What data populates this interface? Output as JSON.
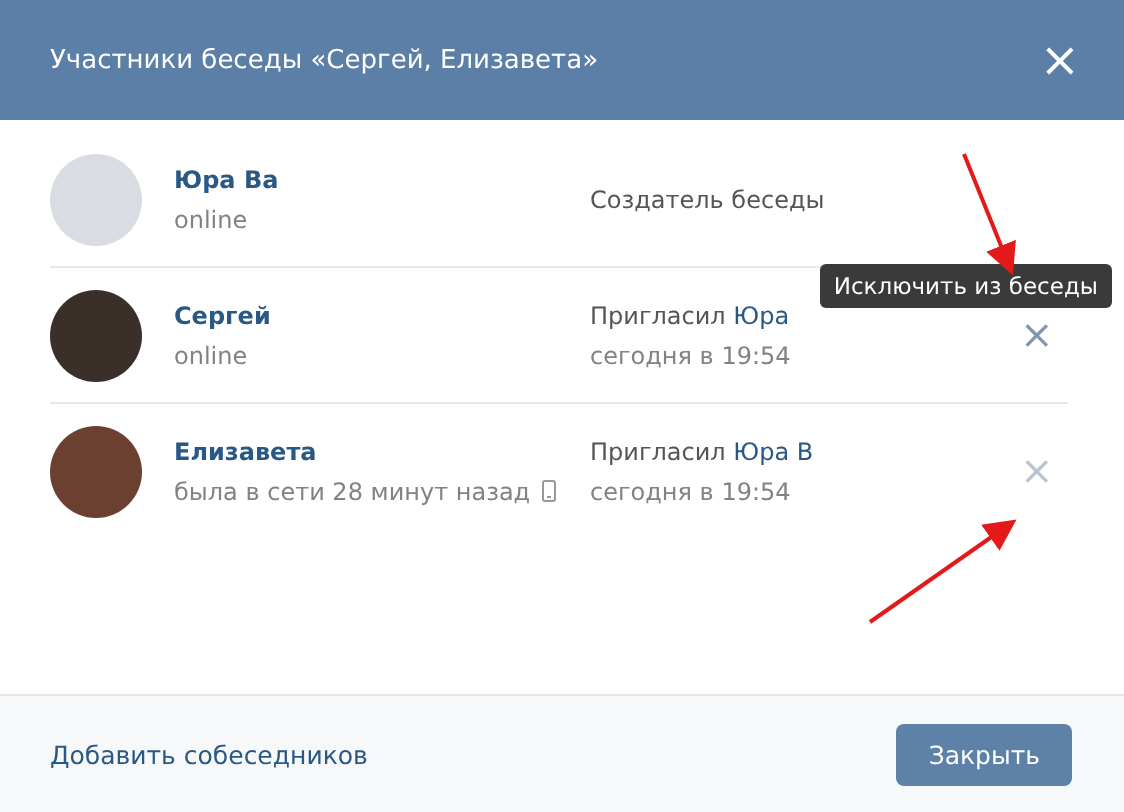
{
  "dialog": {
    "title": "Участники беседы «Сергей, Елизавета»",
    "close": "×"
  },
  "members": [
    {
      "name": "Юра Ва",
      "status": "online",
      "mobile": false,
      "kind": "creator",
      "role": "Создатель беседы"
    },
    {
      "name": "Сергей",
      "status": "online",
      "mobile": false,
      "kind": "invited",
      "invited_label": "Пригласил",
      "inviter": "Юра",
      "time": "сегодня в 19:54",
      "remove": "×",
      "tooltip": "Исключить из беседы"
    },
    {
      "name": "Елизавета",
      "status": "была в сети 28 минут назад",
      "mobile": true,
      "kind": "invited",
      "invited_label": "Пригласил",
      "inviter": "Юра В",
      "time": "сегодня в 19:54",
      "remove": "×"
    }
  ],
  "footer": {
    "add_link": "Добавить собеседников",
    "close_button": "Закрыть"
  }
}
